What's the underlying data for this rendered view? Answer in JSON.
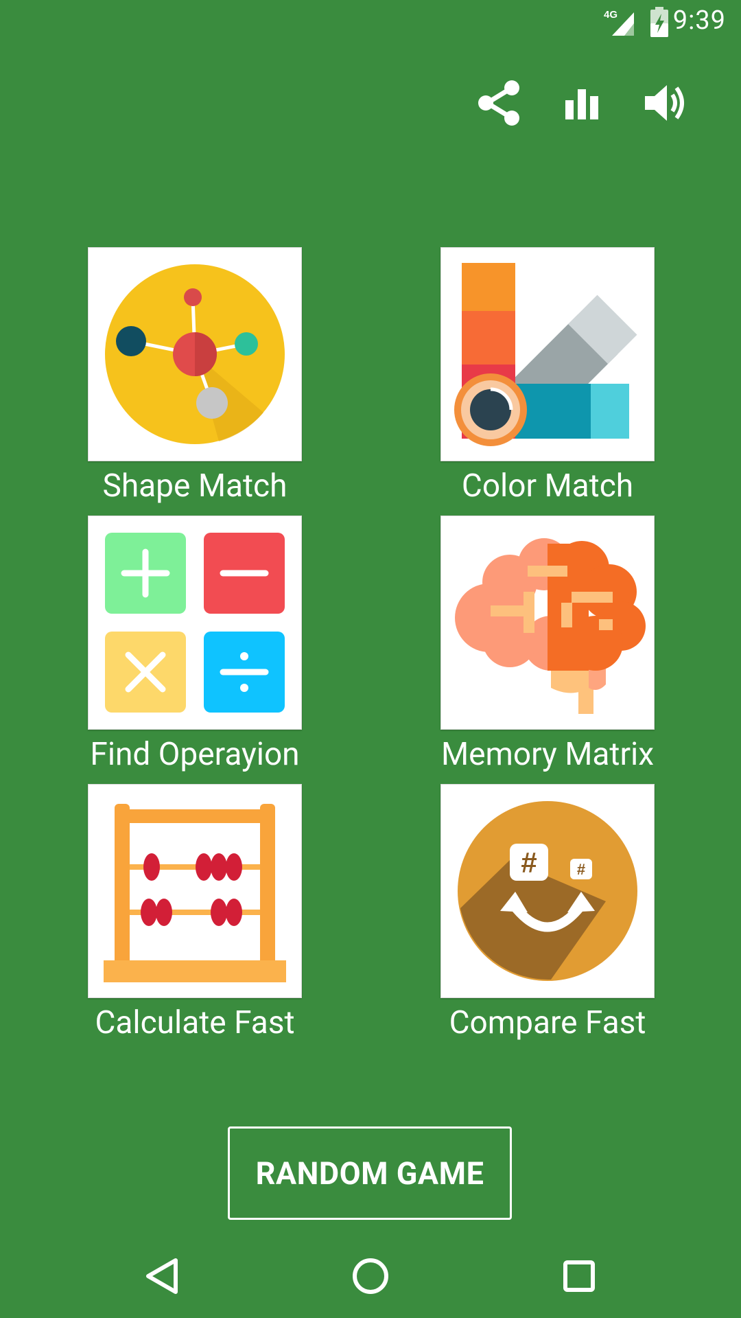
{
  "status_bar": {
    "time": "9:39",
    "network": "4G"
  },
  "toolbar": {
    "icons": [
      "share-icon",
      "leaderboard-icon",
      "volume-icon"
    ]
  },
  "games": [
    {
      "label": "Shape Match",
      "icon": "molecule-icon"
    },
    {
      "label": "Color Match",
      "icon": "color-palette-icon"
    },
    {
      "label": "Find Operayion",
      "icon": "math-operators-icon"
    },
    {
      "label": "Memory Matrix",
      "icon": "brain-icon"
    },
    {
      "label": "Calculate Fast",
      "icon": "abacus-icon"
    },
    {
      "label": "Compare Fast",
      "icon": "compare-hash-icon"
    }
  ],
  "random_button": {
    "label": "RANDOM GAME"
  },
  "nav": {
    "icons": [
      "back-icon",
      "home-icon",
      "recents-icon"
    ]
  },
  "colors": {
    "background": "#3a8c3e",
    "tile": "#ffffff",
    "text": "#ffffff"
  }
}
